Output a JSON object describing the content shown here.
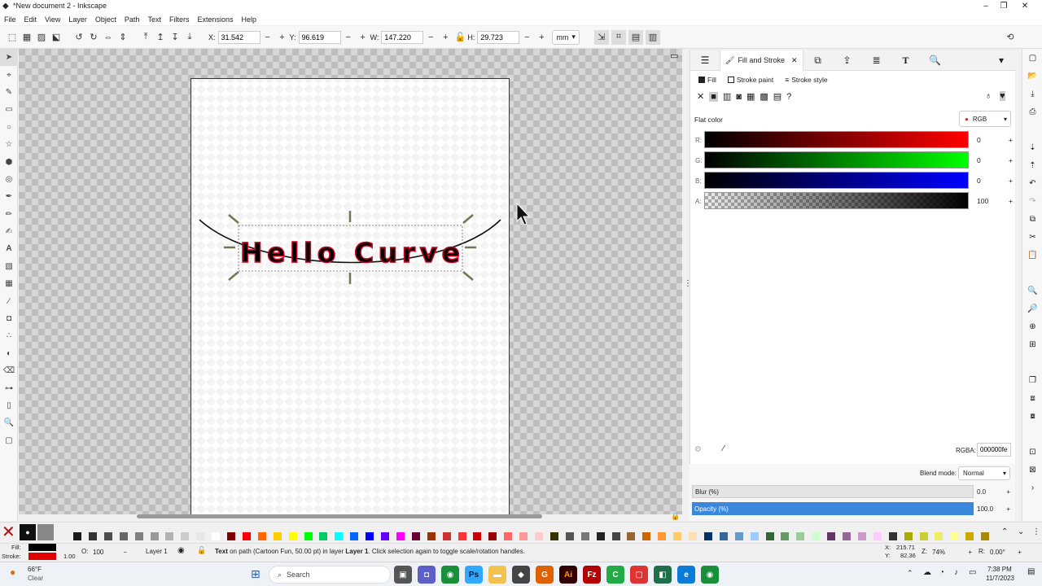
{
  "window": {
    "title": "*New document 2 - Inkscape",
    "minimize": "–",
    "maximize": "❐",
    "close": "✕"
  },
  "menu": [
    "File",
    "Edit",
    "View",
    "Layer",
    "Object",
    "Path",
    "Text",
    "Filters",
    "Extensions",
    "Help"
  ],
  "toolbar": {
    "x_label": "X:",
    "x_value": "31.542",
    "y_label": "Y:",
    "y_value": "96.619",
    "w_label": "W:",
    "w_value": "147.220",
    "h_label": "H:",
    "h_value": "29.723",
    "unit": "mm"
  },
  "canvas": {
    "text": "Hello Curve",
    "text_fill": "#000000",
    "text_stroke": "#d0021b"
  },
  "panel": {
    "tab_label": "Fill and Stroke",
    "subtabs": {
      "fill": "Fill",
      "stroke_paint": "Stroke paint",
      "stroke_style": "Stroke style"
    },
    "flat_color": "Flat color",
    "mode": "RGB",
    "channels": [
      {
        "label": "R:",
        "value": "0"
      },
      {
        "label": "G:",
        "value": "0"
      },
      {
        "label": "B:",
        "value": "0"
      },
      {
        "label": "A:",
        "value": "100"
      }
    ],
    "rgba_label": "RGBA:",
    "rgba_value": "000000fe",
    "blend_label": "Blend mode:",
    "blend_value": "Normal",
    "blur_label": "Blur (%)",
    "blur_value": "0.0",
    "opacity_label": "Opacity (%)",
    "opacity_value": "100.0",
    "help": "?"
  },
  "status": {
    "fill_label": "Fill:",
    "stroke_label": "Stroke:",
    "stroke_width": "1.00",
    "opacity_label": "O:",
    "opacity_value": "100",
    "layer": "Layer 1",
    "message_prefix": "Text",
    "message_body": " on path (Cartoon Fun, 50.00 pt) in layer ",
    "message_layer": "Layer 1",
    "message_suffix": ". Click selection again to toggle scale/rotation handles.",
    "x_label": "X:",
    "x_value": "215.71",
    "y_label": "Y:",
    "y_value": "82.36",
    "z_label": "Z:",
    "zoom": "74%",
    "r_label": "R:",
    "rotation": "0.00°"
  },
  "taskbar": {
    "weather_temp": "66°F",
    "weather_desc": "Clear",
    "search": "Search",
    "time": "7:38 PM",
    "date": "11/7/2023"
  },
  "palette": [
    "#1a1a1a",
    "#333333",
    "#4d4d4d",
    "#666666",
    "#808080",
    "#999999",
    "#b3b3b3",
    "#cccccc",
    "#e6e6e6",
    "#ffffff",
    "#800000",
    "#ff0000",
    "#ff6600",
    "#ffcc00",
    "#ffff00",
    "#00ff00",
    "#00cc66",
    "#00ffff",
    "#0066ff",
    "#0000ff",
    "#6600ff",
    "#ff00ff",
    "#660033",
    "#993300",
    "#cc3333",
    "#ff3333",
    "#cc0000",
    "#990000",
    "#ff6666",
    "#ff9999",
    "#ffcccc",
    "#333300",
    "#555555",
    "#777777",
    "#222222",
    "#444444",
    "#996633",
    "#cc6600",
    "#ff9933",
    "#ffcc66",
    "#ffe0b3",
    "#003366",
    "#336699",
    "#6699cc",
    "#99ccff",
    "#336633",
    "#669966",
    "#99cc99",
    "#ccffcc",
    "#663366",
    "#996699",
    "#cc99cc",
    "#ffccff",
    "#333333",
    "#aaaa00",
    "#cccc33",
    "#eeee66",
    "#ffff99",
    "#ccaa00",
    "#aa8800"
  ]
}
